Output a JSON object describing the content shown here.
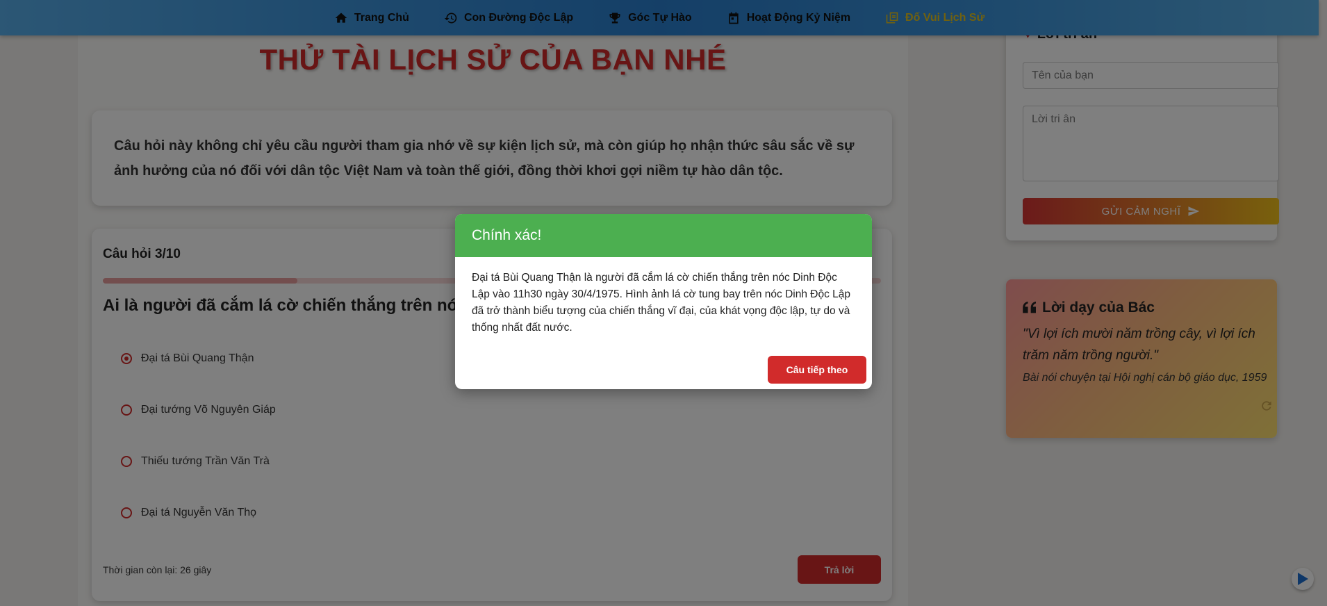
{
  "nav": {
    "items": [
      {
        "label": "Trang Chủ",
        "icon": "home-icon"
      },
      {
        "label": "Con Đường Độc Lập",
        "icon": "history-icon"
      },
      {
        "label": "Góc Tự Hào",
        "icon": "trophy-icon"
      },
      {
        "label": "Hoạt Động Kỷ Niệm",
        "icon": "calendar-icon"
      },
      {
        "label": "Đố Vui Lịch Sử",
        "icon": "quiz-icon"
      }
    ],
    "active_index": 4,
    "active_color": "#e2c21f"
  },
  "page": {
    "title": "THỬ TÀI LỊCH SỬ CỦA BẠN NHÉ",
    "intro": "Câu hỏi này không chỉ yêu cầu người tham gia nhớ về sự kiện lịch sử, mà còn giúp họ nhận thức sâu sắc về sự ảnh hưởng của nó đối với dân tộc Việt Nam và toàn thế giới, đồng thời khơi gợi niềm tự hào dân tộc."
  },
  "quiz": {
    "counter": "Câu hỏi 3/10",
    "progress": 0.25,
    "question": "Ai là người đã cắm lá cờ chiến thắng trên nóc Dinh Độc Lập?",
    "options": [
      {
        "label": "Đại tá Bùi Quang Thận",
        "checked": true
      },
      {
        "label": "Đại tướng Võ Nguyên Giáp",
        "checked": false
      },
      {
        "label": "Thiếu tướng Trần Văn Trà",
        "checked": false
      },
      {
        "label": "Đại tá Nguyễn Văn Thọ",
        "checked": false
      }
    ],
    "timer": "Thời gian còn lại: 26 giây",
    "answer_label": "Trả lời"
  },
  "thanks": {
    "heading": "Lời tri ân",
    "name_placeholder": "Tên của bạn",
    "message_placeholder": "Lời tri ân",
    "send_label": "GỬI CẢM NGHĨ"
  },
  "quote": {
    "heading": "Lời dạy của Bác",
    "text": "\"Vì lợi ích mười năm trồng cây, vì lợi ích trăm năm trồng người.\"",
    "source": "Bài nói chuyện tại Hội nghị cán bộ giáo dục, 1959"
  },
  "modal": {
    "title": "Chính xác!",
    "body": "Đại tá Bùi Quang Thận là người đã cắm lá cờ chiến thắng trên nóc Dinh Độc Lập vào 11h30 ngày 30/4/1975. Hình ảnh lá cờ tung bay trên nóc Dinh Độc Lập đã trở thành biểu tượng của chiến thắng vĩ đại, của khát vọng độc lập, tự do và thống nhất đất nước.",
    "next_label": "Câu tiếp theo",
    "header_color": "#4caf50"
  },
  "colors": {
    "primary_red": "#d12b2b",
    "nav_blue": "#2a7fcf"
  }
}
